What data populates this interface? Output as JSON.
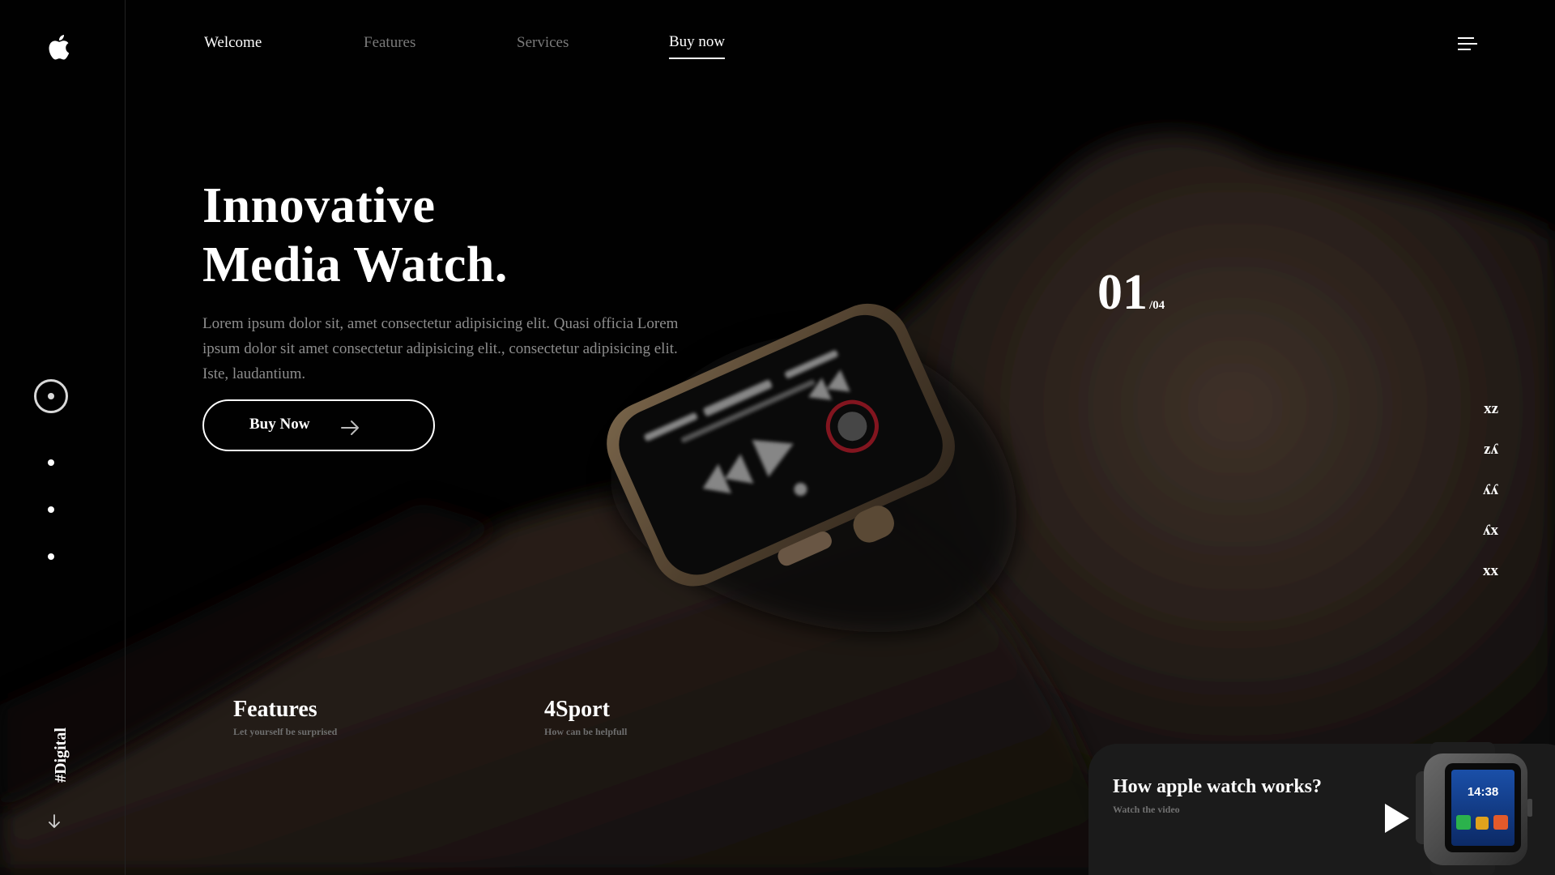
{
  "nav": {
    "items": [
      {
        "label": "Welcome"
      },
      {
        "label": "Features"
      },
      {
        "label": "Services"
      },
      {
        "label": "Buy now"
      }
    ]
  },
  "hero": {
    "title_line1": "Innovative",
    "title_line2": "Media Watch.",
    "description": "Lorem ipsum dolor sit, amet consectetur adipisicing elit. Quasi officia Lorem ipsum dolor sit amet consectetur adipisicing elit., consectetur adipisicing elit. Iste, laudantium.",
    "button_label": "Buy Now"
  },
  "counter": {
    "current": "01",
    "total": "/04"
  },
  "side_list": [
    "xz",
    "zʎ",
    "ʎʎ",
    "ʎx",
    "xx"
  ],
  "sidebar": {
    "tag": "#Digital"
  },
  "features": [
    {
      "title": "Features",
      "subtitle": "Let yourself be surprised"
    },
    {
      "title": "4Sport",
      "subtitle": "How can be helpfull"
    }
  ],
  "video_card": {
    "title": "How apple watch works?",
    "subtitle": "Watch the video",
    "thumb_time": "14:38"
  },
  "colors": {
    "background": "#020202",
    "text": "#ffffff",
    "muted_text": "#8d8d8d",
    "card": "#1b1b1b"
  },
  "icons": {
    "logo": "apple-logo-icon",
    "menu": "hamburger-menu-icon",
    "target": "target-icon",
    "arrow_right": "arrow-right-icon",
    "arrow_down": "arrow-down-icon",
    "play": "play-icon"
  }
}
